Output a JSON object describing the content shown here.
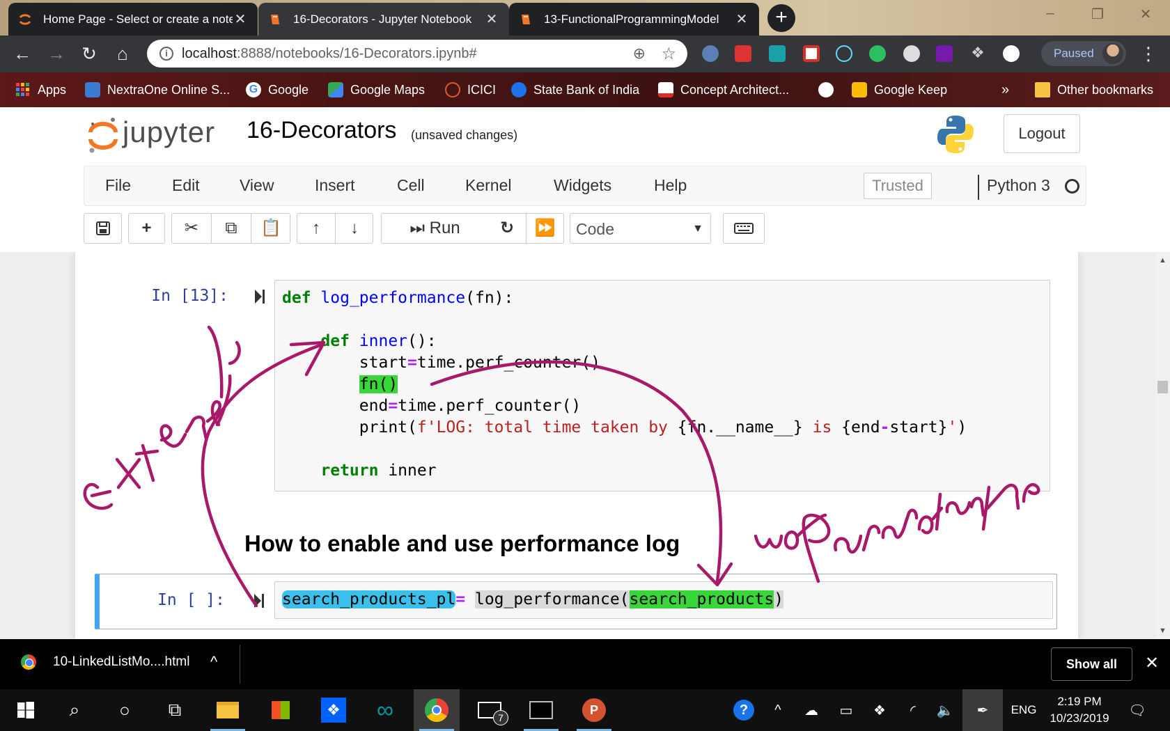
{
  "browser": {
    "tabs": [
      {
        "title": "Home Page - Select or create a notebook",
        "icon": "jupyter-icon"
      },
      {
        "title": "16-Decorators - Jupyter Notebook",
        "icon": "notebook-icon"
      },
      {
        "title": "13-FunctionalProgrammingModel",
        "icon": "notebook-icon"
      }
    ],
    "url_host": "localhost",
    "url_path": ":8888/notebooks/16-Decorators.ipynb#",
    "profile_status": "Paused",
    "bookmarks": [
      "Apps",
      "NextraOne Online S...",
      "Google",
      "Google Maps",
      "ICICI",
      "State Bank of India",
      "Concept Architect...",
      "Google Keep"
    ],
    "bookmarks_overflow": "»",
    "other_bookmarks": "Other bookmarks"
  },
  "jupyter": {
    "logo_text": "jupyter",
    "notebook_name": "16-Decorators",
    "save_status": "(unsaved changes)",
    "logout_label": "Logout",
    "menu": [
      "File",
      "Edit",
      "View",
      "Insert",
      "Cell",
      "Kernel",
      "Widgets",
      "Help"
    ],
    "trusted_label": "Trusted",
    "kernel_name": "Python 3",
    "run_label": "Run",
    "cell_type": "Code"
  },
  "cells": {
    "code_cell_prompt": "In [13]:",
    "code_cell_source": "def log_performance(fn):\n\n    def inner():\n        start=time.perf_counter()\n        fn()\n        end=time.perf_counter()\n        print(f'LOG: total time taken by {fn.__name__} is {end-start}')\n\n    return inner",
    "markdown_heading": "How to enable and use performance log",
    "active_cell_prompt": "In [ ]:",
    "active_cell_source": "search_products_pl= log_performance(search_products)"
  },
  "annotations": {
    "ink_color": "#a8196a",
    "highlight_green": "#39d63a",
    "highlight_blue": "#3ac0ea",
    "handwriting": [
      "Extend's",
      "wo",
      "Parameters"
    ]
  },
  "downloads": {
    "file": "10-LinkedListMo....html",
    "show_all_label": "Show all"
  },
  "taskbar": {
    "badge_count": "7",
    "language": "ENG",
    "time": "2:19 PM",
    "date": "10/23/2019"
  }
}
